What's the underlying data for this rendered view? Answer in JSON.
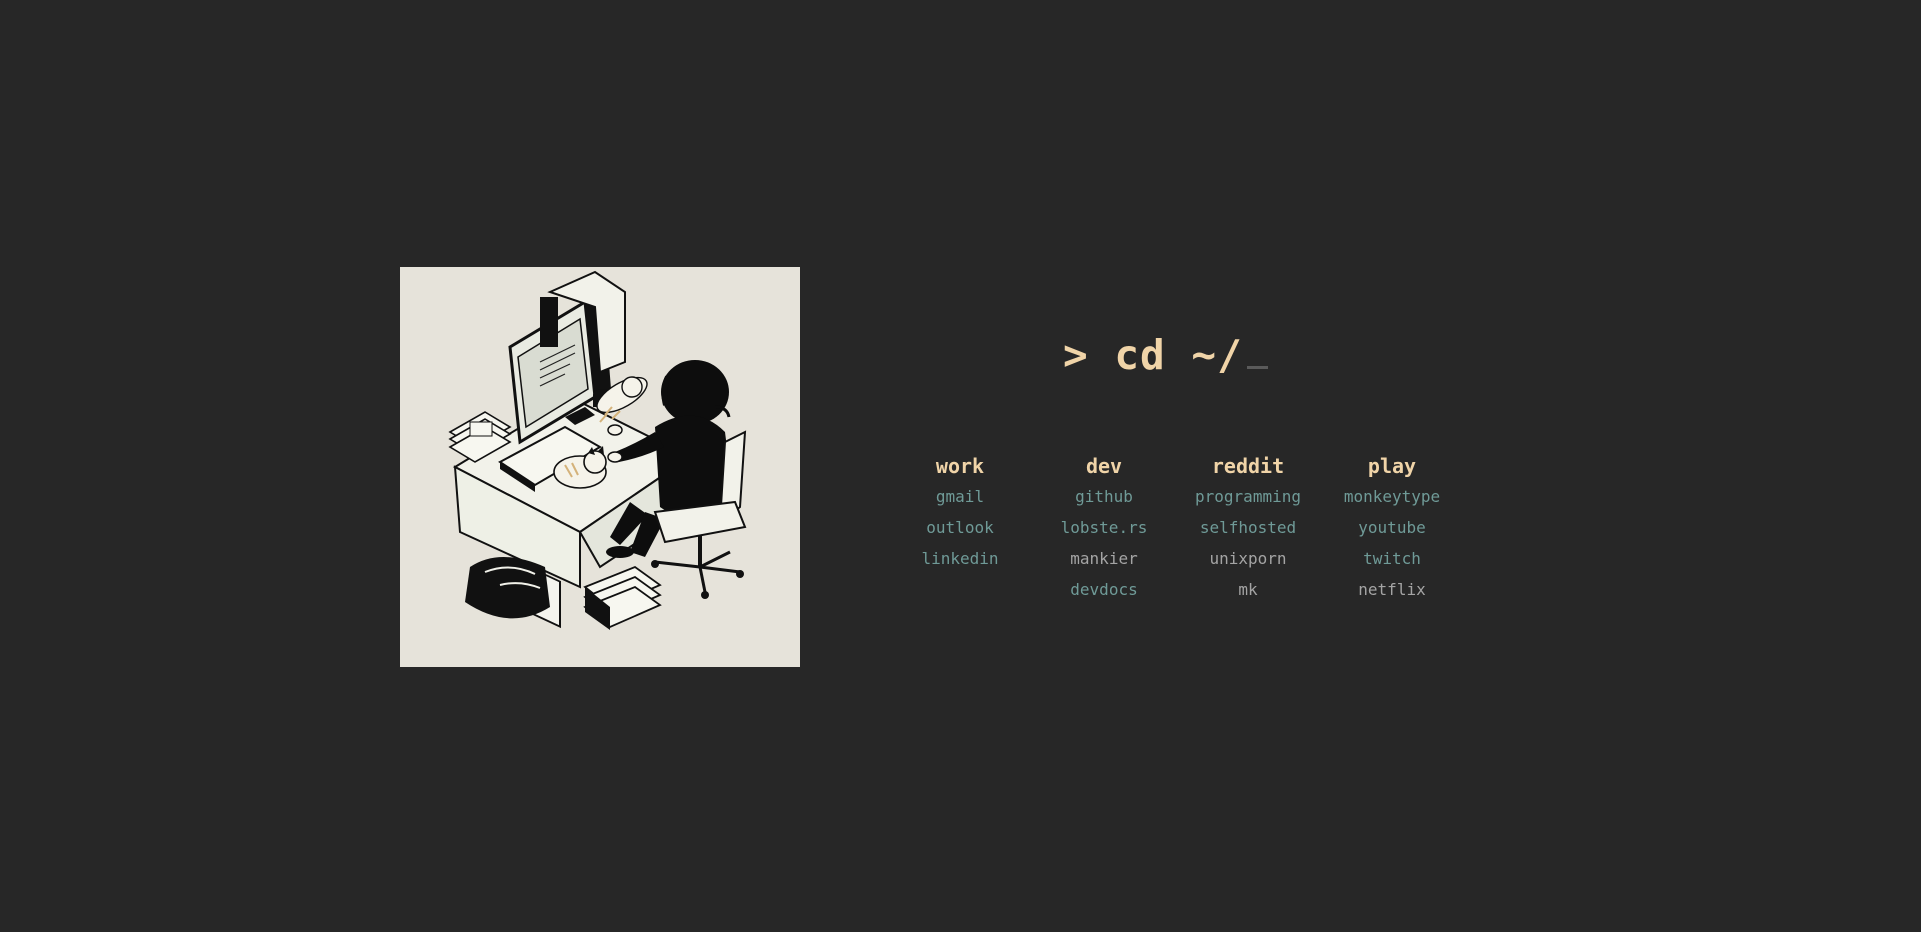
{
  "prompt": {
    "text": "> cd ~/",
    "cursor": "_"
  },
  "columns": [
    {
      "title": "work",
      "links": [
        {
          "label": "gmail",
          "style": "teal"
        },
        {
          "label": "outlook",
          "style": "teal"
        },
        {
          "label": "linkedin",
          "style": "teal"
        }
      ]
    },
    {
      "title": "dev",
      "links": [
        {
          "label": "github",
          "style": "teal"
        },
        {
          "label": "lobste.rs",
          "style": "teal"
        },
        {
          "label": "mankier",
          "style": "gray"
        },
        {
          "label": "devdocs",
          "style": "teal"
        }
      ]
    },
    {
      "title": "reddit",
      "links": [
        {
          "label": "programming",
          "style": "teal"
        },
        {
          "label": "selfhosted",
          "style": "teal"
        },
        {
          "label": "unixporn",
          "style": "gray"
        },
        {
          "label": "mk",
          "style": "gray"
        }
      ]
    },
    {
      "title": "play",
      "links": [
        {
          "label": "monkeytype",
          "style": "teal"
        },
        {
          "label": "youtube",
          "style": "teal"
        },
        {
          "label": "twitch",
          "style": "teal"
        },
        {
          "label": "netflix",
          "style": "gray"
        }
      ]
    }
  ],
  "colors": {
    "background": "#272727",
    "accent": "#f0d4a8",
    "link_teal": "#6f9a97",
    "link_gray": "#a4a4a4",
    "illustration_bg": "#e6e3da"
  },
  "illustration": {
    "icon": "desk-illustration"
  }
}
